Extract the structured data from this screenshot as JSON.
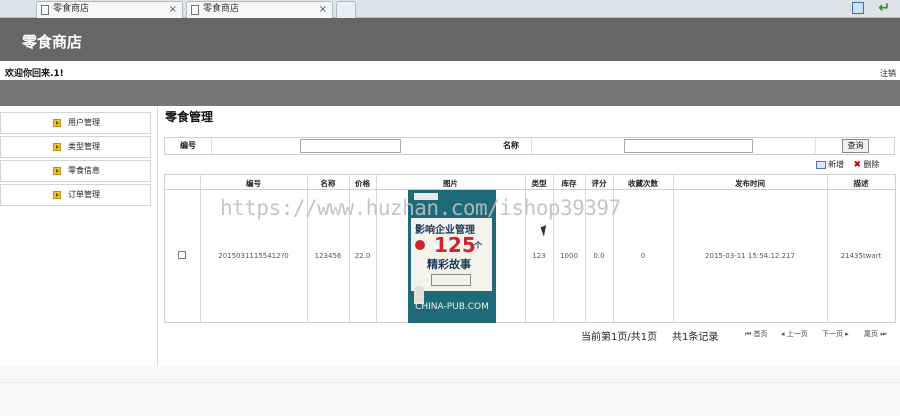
{
  "browser": {
    "tabs": [
      {
        "label": "零食商店"
      },
      {
        "label": "零食商店"
      }
    ],
    "close_symbol": "×",
    "icons": [
      "home-icon",
      "back-icon"
    ]
  },
  "header": {
    "title": "零食商店"
  },
  "top_bar": {
    "welcome": "欢迎你回来.1!",
    "logout": "注销"
  },
  "sidebar": {
    "items": [
      {
        "label": "用户管理"
      },
      {
        "label": "类型管理"
      },
      {
        "label": "零食信息"
      },
      {
        "label": "订单管理"
      }
    ]
  },
  "main": {
    "title": "零食管理",
    "search": {
      "id_label": "编号",
      "name_label": "名称",
      "id_value": "",
      "name_value": "",
      "button": "查询"
    },
    "actions": {
      "add": "新增",
      "delete": "删除"
    },
    "table": {
      "columns": [
        "编号",
        "名称",
        "价格",
        "图片",
        "类型",
        "库存",
        "评分",
        "收藏次数",
        "发布时间",
        "描述"
      ],
      "rows": [
        {
          "id": "20150311155412?0",
          "name": "123456",
          "price": "22.0",
          "image": {
            "title_line1": "影响企业管理",
            "number": "125",
            "unit": "个",
            "title_line2": "精彩故事",
            "brand": "CHINA-PUB.COM"
          },
          "type": "123",
          "stock": "1000",
          "rating": "0.0",
          "favorites": "0",
          "published": "2015-03-11 15:54:12.217",
          "description": "21435twart"
        }
      ]
    },
    "pager": {
      "status": "当前第1页/共1页",
      "total": "共1条记录",
      "first": "首页",
      "prev": "上一页",
      "next": "下一页",
      "last": "尾页"
    }
  },
  "watermark": "https://www.huzhan.com/ishop39397",
  "colors": {
    "header_bg": "#666666",
    "bar_bg": "#777777",
    "book_bg": "#1e6a78",
    "accent_red": "#d2222a"
  }
}
